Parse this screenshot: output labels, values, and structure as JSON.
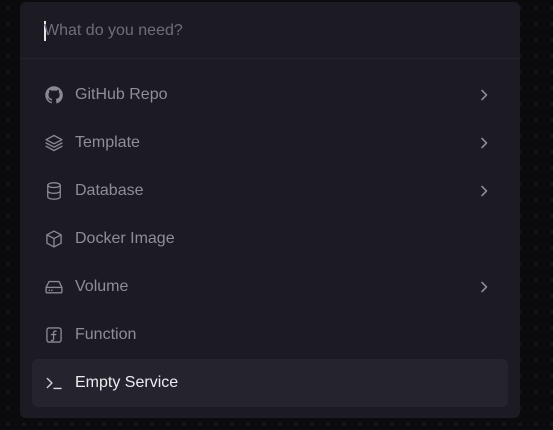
{
  "search": {
    "placeholder": "What do you need?",
    "value": ""
  },
  "menu": {
    "items": [
      {
        "label": "GitHub Repo",
        "icon": "github-icon",
        "has_submenu": true
      },
      {
        "label": "Template",
        "icon": "layers-icon",
        "has_submenu": true
      },
      {
        "label": "Database",
        "icon": "database-icon",
        "has_submenu": true
      },
      {
        "label": "Docker Image",
        "icon": "box-icon",
        "has_submenu": false
      },
      {
        "label": "Volume",
        "icon": "hard-drive-icon",
        "has_submenu": true
      },
      {
        "label": "Function",
        "icon": "function-icon",
        "has_submenu": false
      },
      {
        "label": "Empty Service",
        "icon": "terminal-icon",
        "has_submenu": false,
        "active": true
      }
    ]
  },
  "colors": {
    "background": "#0b0b0e",
    "panel": "#1c1b24",
    "active_row": "#25242e",
    "text_muted": "#8e8d99",
    "text_active": "#ececf0"
  }
}
